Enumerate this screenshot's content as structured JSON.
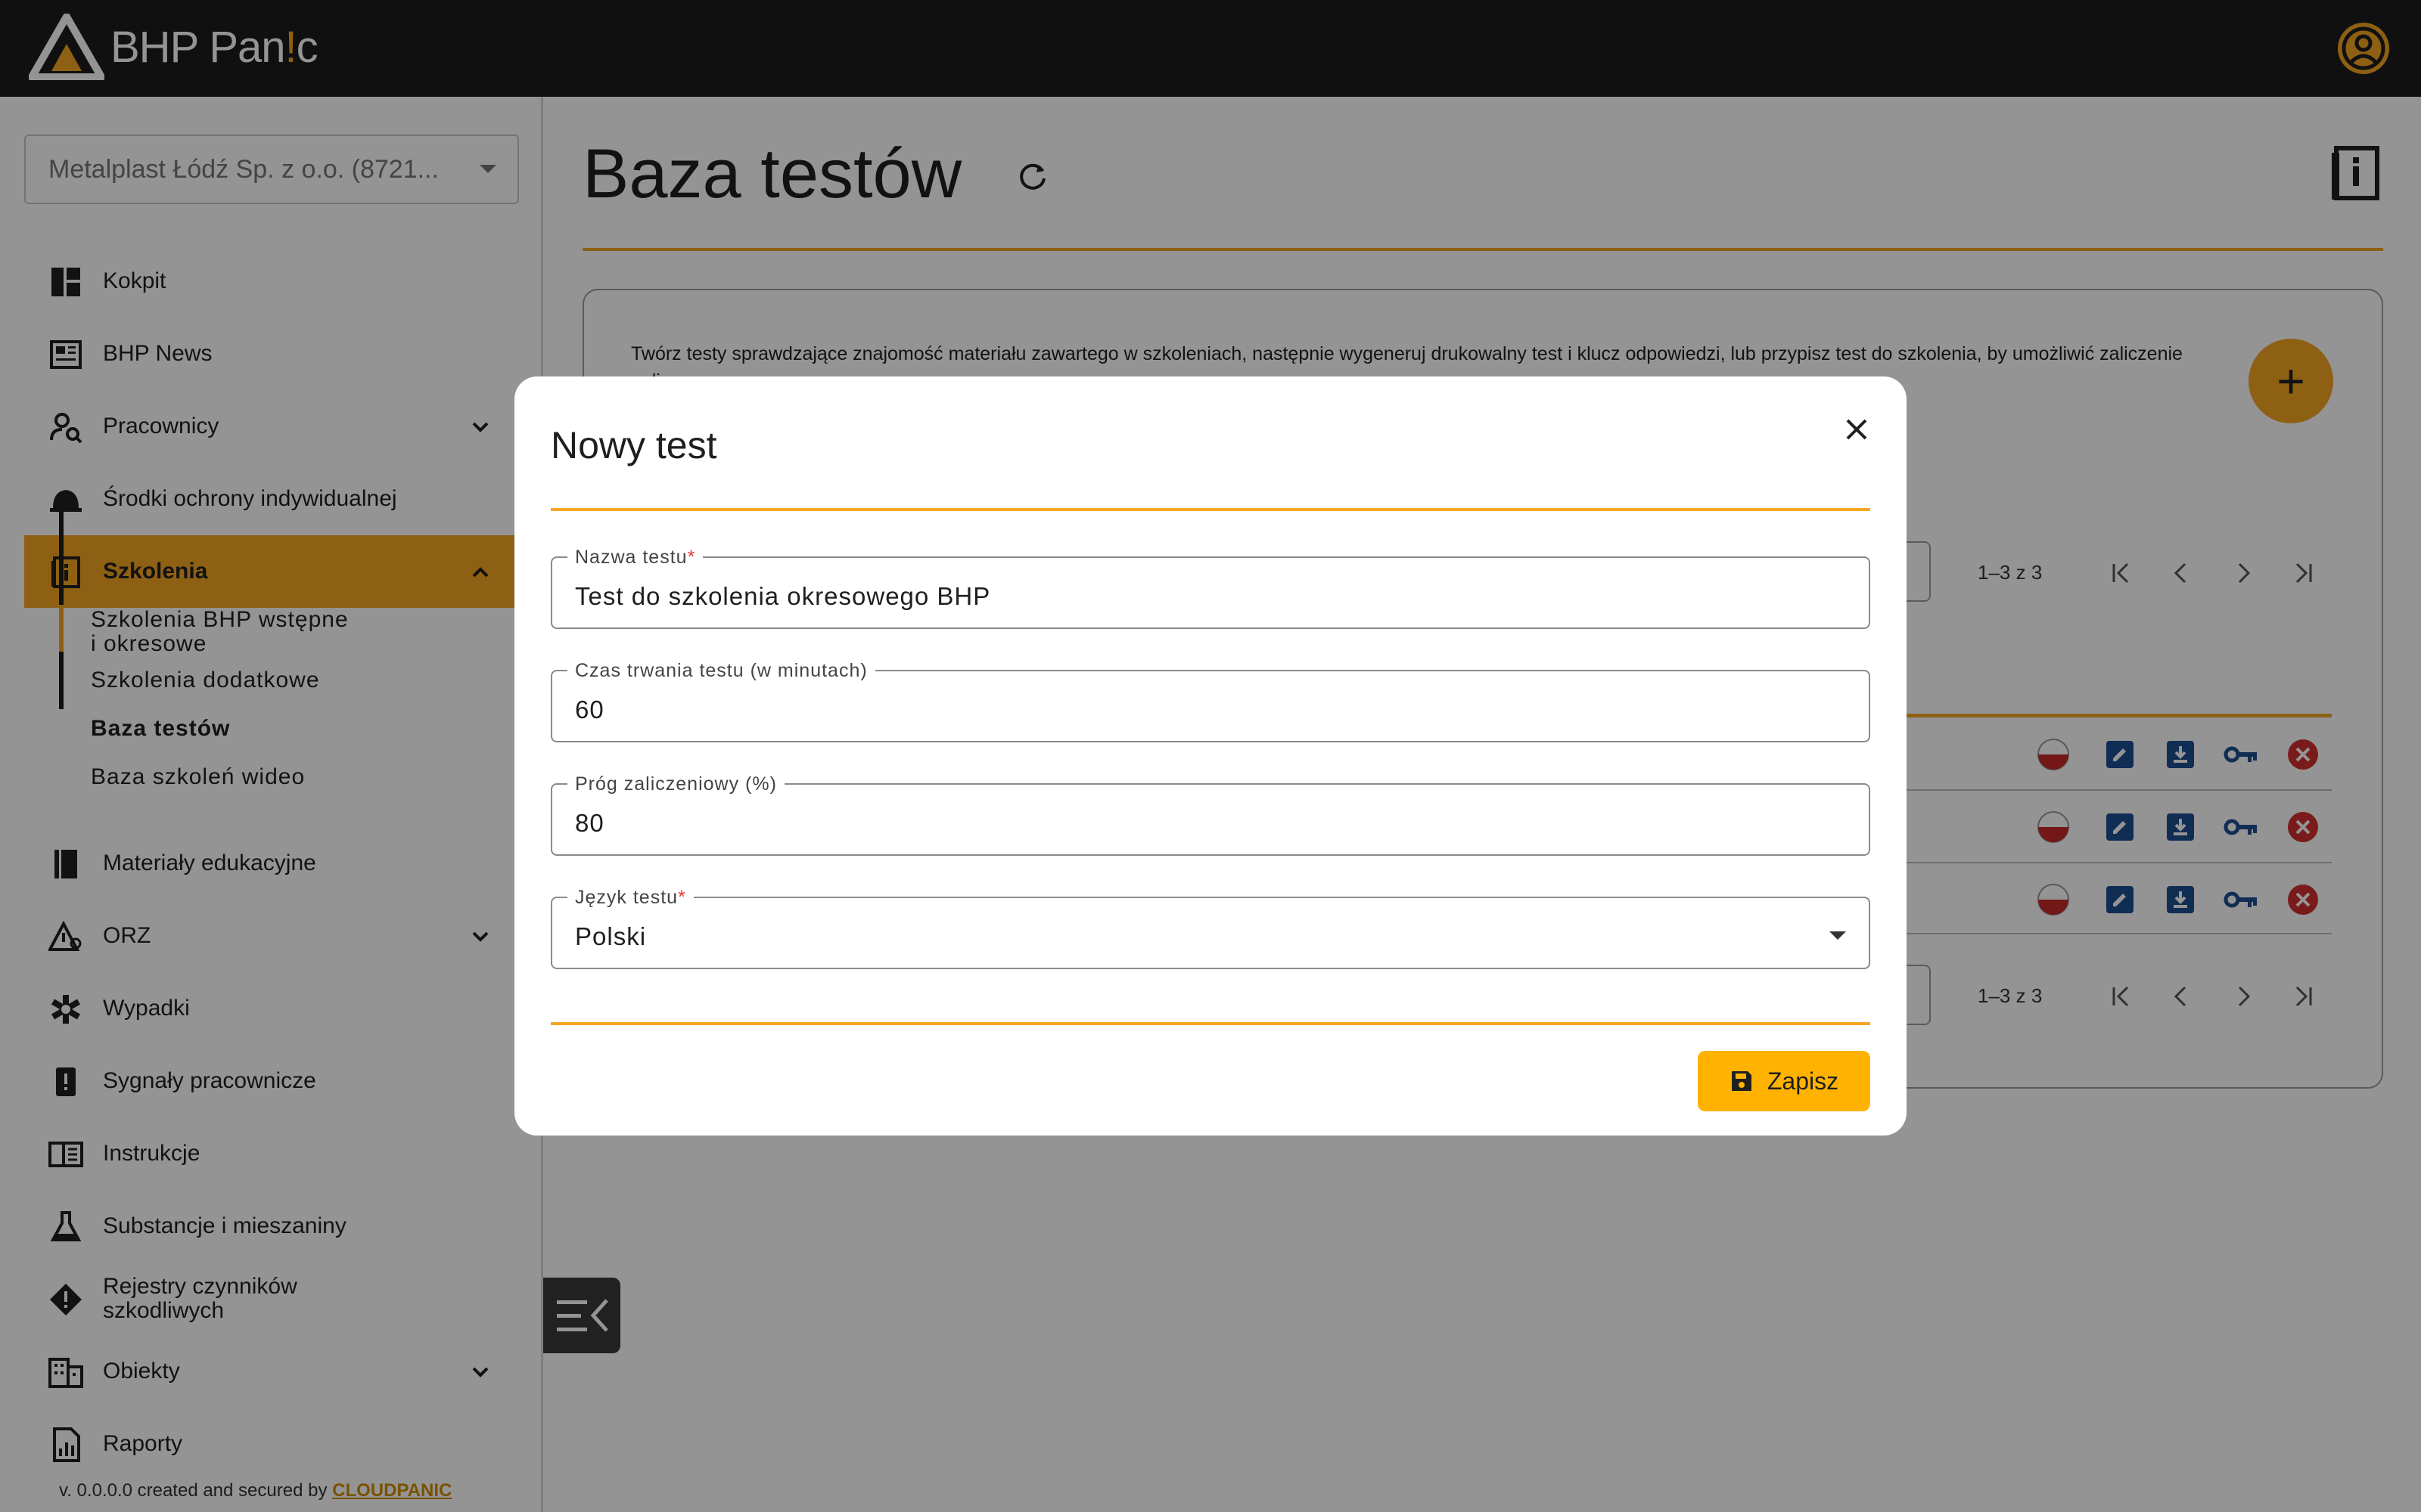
{
  "app": {
    "logo_prefix": "BHP Pan",
    "logo_accent": "!",
    "logo_suffix": "c"
  },
  "sidebar": {
    "company_selector": "Metalplast Łódź Sp. z o.o. (8721...",
    "items": [
      {
        "label": "Kokpit",
        "icon": "dashboard-icon"
      },
      {
        "label": "BHP News",
        "icon": "newspaper-icon"
      },
      {
        "label": "Pracownicy",
        "icon": "person-search-icon"
      },
      {
        "label": "Środki ochrony indywidualnej",
        "icon": "helmet-icon"
      },
      {
        "label": "Szkolenia",
        "icon": "training-book-icon"
      },
      {
        "label": "Materiały edukacyjne",
        "icon": "book-icon"
      },
      {
        "label": "ORZ",
        "icon": "risk-assessment-icon"
      },
      {
        "label": "Wypadki",
        "icon": "medical-icon"
      },
      {
        "label": "Sygnały pracownicze",
        "icon": "alert-report-icon"
      },
      {
        "label": "Instrukcje",
        "icon": "instructions-icon"
      },
      {
        "label": "Substancje i mieszaniny",
        "icon": "flask-icon"
      },
      {
        "label_line1": "Rejestry czynników",
        "label_line2": "szkodliwych",
        "icon": "warning-diamond-icon"
      },
      {
        "label": "Obiekty",
        "icon": "building-icon"
      },
      {
        "label": "Raporty",
        "icon": "report-icon"
      }
    ],
    "sub_items": [
      {
        "line1": "Szkolenia BHP wstępne",
        "line2": "i okresowe"
      },
      {
        "label": "Szkolenia dodatkowe"
      },
      {
        "label": "Baza testów"
      },
      {
        "label": "Baza szkoleń wideo"
      }
    ],
    "footer_prefix": "v. 0.0.0.0 created and secured by ",
    "footer_brand": "CLOUDPANIC"
  },
  "main": {
    "title": "Baza testów",
    "description": "Twórz testy sprawdzające znajomość materiału zawartego w szkoleniach, następnie wygeneruj drukowalny test i klucz odpowiedzi, lub przypisz test do szkolenia, by umożliwić zaliczenie online.",
    "add_button": "+",
    "pager_text": "1–3 z 3",
    "rows": 3
  },
  "modal": {
    "title": "Nowy test",
    "fields": [
      {
        "label": "Nazwa testu",
        "required": "*",
        "value": "Test do szkolenia okresowego BHP"
      },
      {
        "label": "Czas trwania testu (w minutach)",
        "required": "",
        "value": "60"
      },
      {
        "label": "Próg zaliczeniowy (%)",
        "required": "",
        "value": "80"
      },
      {
        "label": "Język testu",
        "required": "*",
        "value": "Polski"
      }
    ],
    "save_label": "Zapisz"
  },
  "colors": {
    "accent": "#f5a623",
    "topbar": "#1c1c1c",
    "action_blue": "#1d4f91",
    "delete_red": "#d32f2f"
  }
}
